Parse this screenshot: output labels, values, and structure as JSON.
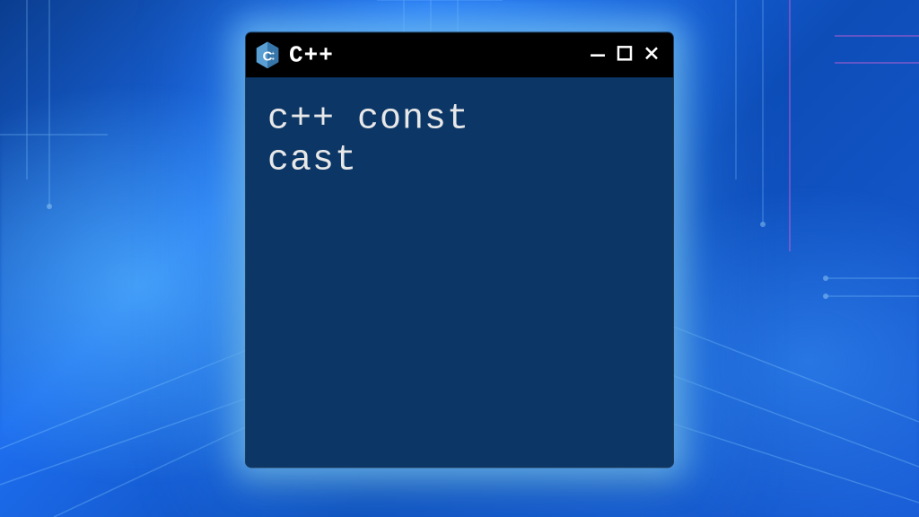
{
  "window": {
    "title": "C++",
    "content": "c++ const\ncast"
  },
  "controls": {
    "minimize": "–",
    "maximize": "☐",
    "close": "✕"
  }
}
